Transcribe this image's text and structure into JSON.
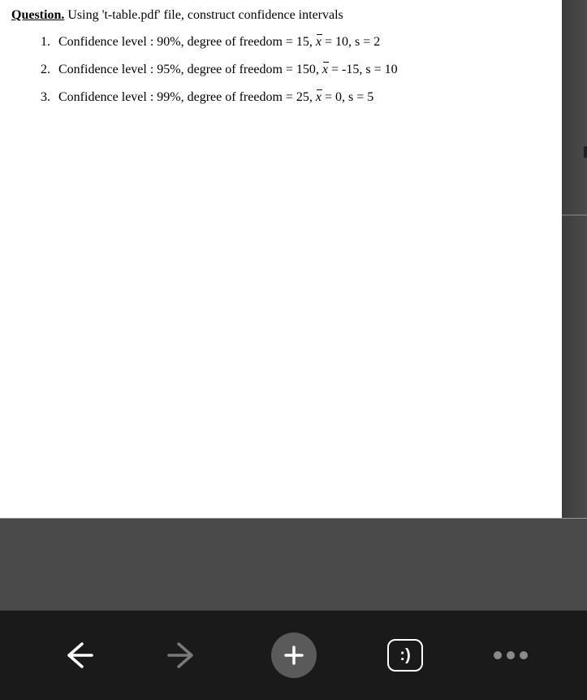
{
  "question": {
    "label": "Question.",
    "prompt": "Using 't-table.pdf' file, construct confidence intervals"
  },
  "items": [
    {
      "num": "1.",
      "pre": "Confidence level : 90%, degree of freedom = 15,  ",
      "xvar": "x",
      "post": "  = 10, s = 2"
    },
    {
      "num": "2.",
      "pre": "Confidence level : 95%, degree of freedom = 150,  ",
      "xvar": "x",
      "post": "  = -15, s = 10"
    },
    {
      "num": "3.",
      "pre": "Confidence level : 99%, degree of freedom = 25,  ",
      "xvar": "x",
      "post": "  = 0, s = 5"
    }
  ],
  "toolbar": {
    "smiley": ":)"
  }
}
